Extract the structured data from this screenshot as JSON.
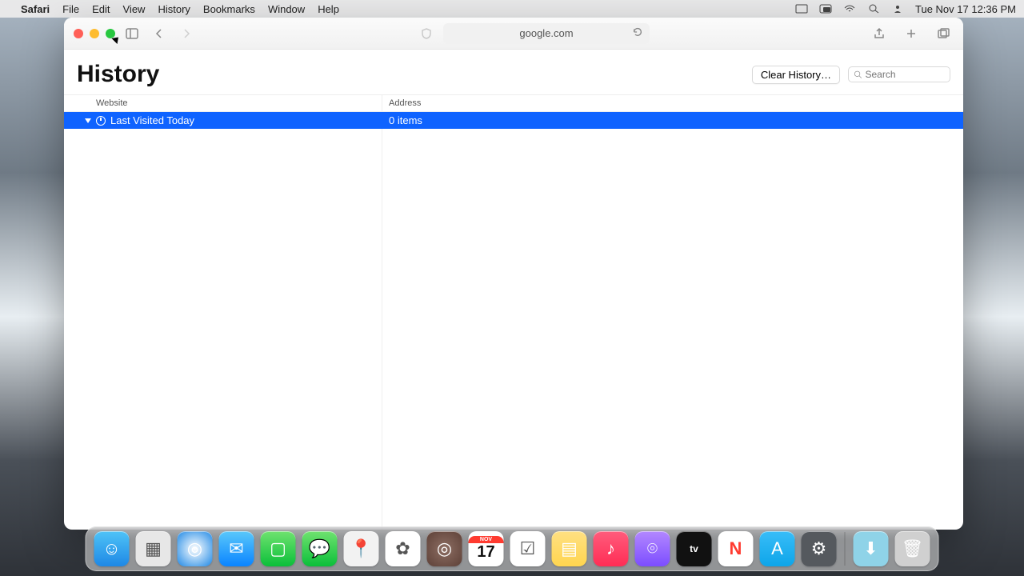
{
  "menubar": {
    "app": "Safari",
    "items": [
      "File",
      "Edit",
      "View",
      "History",
      "Bookmarks",
      "Window",
      "Help"
    ],
    "clock": "Tue Nov 17  12:36 PM"
  },
  "toolbar": {
    "address": "google.com"
  },
  "history": {
    "title": "History",
    "clear_label": "Clear History…",
    "search_placeholder": "Search",
    "col_website": "Website",
    "col_address": "Address",
    "group_label": "Last Visited Today",
    "group_count": "0 items"
  },
  "dock": {
    "items": [
      {
        "name": "finder",
        "bg": "linear-gradient(#4fc3f7,#1e88e5)",
        "glyph": "☺"
      },
      {
        "name": "launchpad",
        "bg": "#e7e7e7",
        "glyph": "▦"
      },
      {
        "name": "safari",
        "bg": "radial-gradient(#fff,#1e88e5)",
        "glyph": "◎"
      },
      {
        "name": "mail",
        "bg": "linear-gradient(#5ac8fa,#0a84ff)",
        "glyph": "✉"
      },
      {
        "name": "facetime",
        "bg": "linear-gradient(#6fe26f,#0bbf3a)",
        "glyph": "▢"
      },
      {
        "name": "messages",
        "bg": "linear-gradient(#6fe26f,#0bbf3a)",
        "glyph": "💬"
      },
      {
        "name": "maps",
        "bg": "#f2f2f2",
        "glyph": "📍"
      },
      {
        "name": "photos",
        "bg": "#fff",
        "glyph": "✿"
      },
      {
        "name": "findmy",
        "bg": "radial-gradient(#8d6e63,#5d4037)",
        "glyph": "◎"
      },
      {
        "name": "calendar",
        "bg": "#fff",
        "glyph": "17"
      },
      {
        "name": "reminders",
        "bg": "#fff",
        "glyph": "☑"
      },
      {
        "name": "notes",
        "bg": "linear-gradient(#ffe082,#ffd54f)",
        "glyph": "▤"
      },
      {
        "name": "music",
        "bg": "linear-gradient(#ff5c7c,#ff2d55)",
        "glyph": "♪"
      },
      {
        "name": "podcasts",
        "bg": "linear-gradient(#b388ff,#7c4dff)",
        "glyph": "⌾"
      },
      {
        "name": "tv",
        "bg": "#111",
        "glyph": "tv"
      },
      {
        "name": "news",
        "bg": "#fff",
        "glyph": "N"
      },
      {
        "name": "appstore",
        "bg": "linear-gradient(#38bdf8,#0ea5e9)",
        "glyph": "A"
      },
      {
        "name": "settings",
        "bg": "#55595e",
        "glyph": "⚙"
      },
      {
        "name": "downloads",
        "bg": "#8fd3e8",
        "glyph": "⬇"
      },
      {
        "name": "trash",
        "bg": "#d0d0d0",
        "glyph": "🗑"
      }
    ],
    "separator_before": "downloads",
    "calendar_month": "NOV"
  }
}
